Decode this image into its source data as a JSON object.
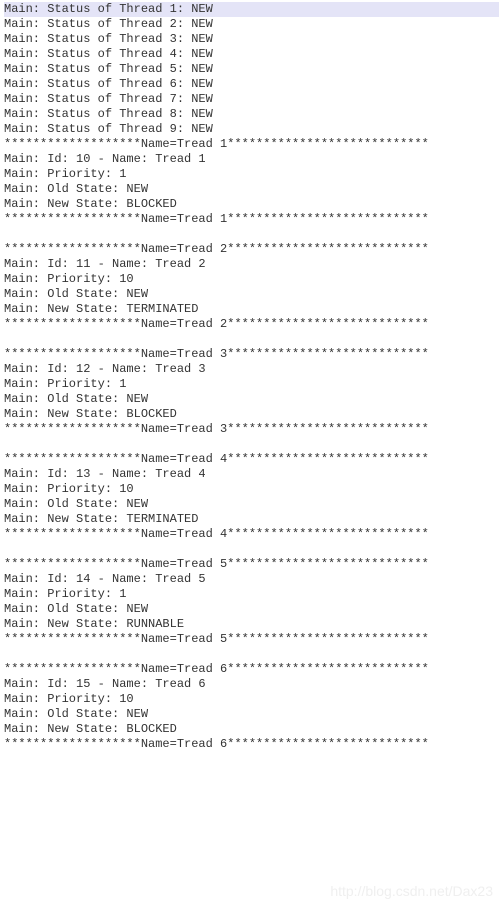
{
  "status_lines": [
    "Main: Status of Thread 1: NEW",
    "Main: Status of Thread 2: NEW",
    "Main: Status of Thread 3: NEW",
    "Main: Status of Thread 4: NEW",
    "Main: Status of Thread 5: NEW",
    "Main: Status of Thread 6: NEW",
    "Main: Status of Thread 7: NEW",
    "Main: Status of Thread 8: NEW",
    "Main: Status of Thread 9: NEW"
  ],
  "thread_blocks": [
    {
      "header": "*******************Name=Tread 1****************************",
      "id_line": "Main: Id: 10 - Name: Tread 1",
      "priority_line": "Main: Priority: 1",
      "old_state_line": "Main: Old State: NEW",
      "new_state_line": "Main: New State: BLOCKED",
      "footer": "*******************Name=Tread 1****************************"
    },
    {
      "header": "*******************Name=Tread 2****************************",
      "id_line": "Main: Id: 11 - Name: Tread 2",
      "priority_line": "Main: Priority: 10",
      "old_state_line": "Main: Old State: NEW",
      "new_state_line": "Main: New State: TERMINATED",
      "footer": "*******************Name=Tread 2****************************"
    },
    {
      "header": "*******************Name=Tread 3****************************",
      "id_line": "Main: Id: 12 - Name: Tread 3",
      "priority_line": "Main: Priority: 1",
      "old_state_line": "Main: Old State: NEW",
      "new_state_line": "Main: New State: BLOCKED",
      "footer": "*******************Name=Tread 3****************************"
    },
    {
      "header": "*******************Name=Tread 4****************************",
      "id_line": "Main: Id: 13 - Name: Tread 4",
      "priority_line": "Main: Priority: 10",
      "old_state_line": "Main: Old State: NEW",
      "new_state_line": "Main: New State: TERMINATED",
      "footer": "*******************Name=Tread 4****************************"
    },
    {
      "header": "*******************Name=Tread 5****************************",
      "id_line": "Main: Id: 14 - Name: Tread 5",
      "priority_line": "Main: Priority: 1",
      "old_state_line": "Main: Old State: NEW",
      "new_state_line": "Main: New State: RUNNABLE",
      "footer": "*******************Name=Tread 5****************************"
    },
    {
      "header": "*******************Name=Tread 6****************************",
      "id_line": "Main: Id: 15 - Name: Tread 6",
      "priority_line": "Main: Priority: 10",
      "old_state_line": "Main: Old State: NEW",
      "new_state_line": "Main: New State: BLOCKED",
      "footer": "*******************Name=Tread 6****************************"
    }
  ],
  "watermark": "http://blog.csdn.net/Dax23"
}
